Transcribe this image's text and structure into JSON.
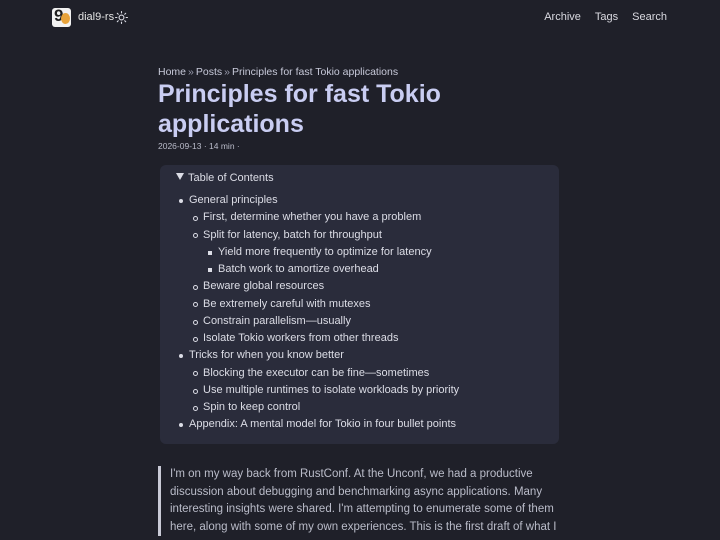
{
  "header": {
    "site_title": "dial9-rs",
    "nav": [
      "Archive",
      "Tags",
      "Search"
    ]
  },
  "breadcrumb": {
    "items": [
      "Home",
      "Posts",
      "Principles for fast Tokio applications"
    ],
    "separator": "»"
  },
  "post": {
    "title": "Principles for fast Tokio applications",
    "meta": "2026-09-13 · 14 min ·"
  },
  "toc": {
    "summary": "Table of Contents",
    "items": [
      {
        "label": "General principles",
        "level": 0
      },
      {
        "label": "First, determine whether you have a problem",
        "level": 1
      },
      {
        "label": "Split for latency, batch for throughput",
        "level": 1
      },
      {
        "label": "Yield more frequently to optimize for latency",
        "level": 2
      },
      {
        "label": "Batch work to amortize overhead",
        "level": 2
      },
      {
        "label": "Beware global resources",
        "level": 1
      },
      {
        "label": "Be extremely careful with mutexes",
        "level": 1
      },
      {
        "label": "Constrain parallelism—usually",
        "level": 1
      },
      {
        "label": "Isolate Tokio workers from other threads",
        "level": 1
      },
      {
        "label": "Tricks for when you know better",
        "level": 0
      },
      {
        "label": "Blocking the executor can be fine—sometimes",
        "level": 1
      },
      {
        "label": "Use multiple runtimes to isolate workloads by priority",
        "level": 1
      },
      {
        "label": "Spin to keep control",
        "level": 1
      },
      {
        "label": "Appendix: A mental model for Tokio in four bullet points",
        "level": 0
      }
    ]
  },
  "content": {
    "intro": "I'm on my way back from RustConf. At the Unconf, we had a productive discussion about debugging and benchmarking async applications. Many interesting insights were shared. I'm attempting to enumerate some of them here, along with some of my own experiences. This is the first draft of what I"
  },
  "colors": {
    "background": "#1f2029",
    "toc_background": "#2a2c3b",
    "title": "#c9cdf2",
    "logo_accent": "#e8a33a"
  },
  "icons": {
    "logo": "dial9-logo",
    "theme_toggle": "sun-icon",
    "toc_toggle": "triangle-down-icon"
  }
}
